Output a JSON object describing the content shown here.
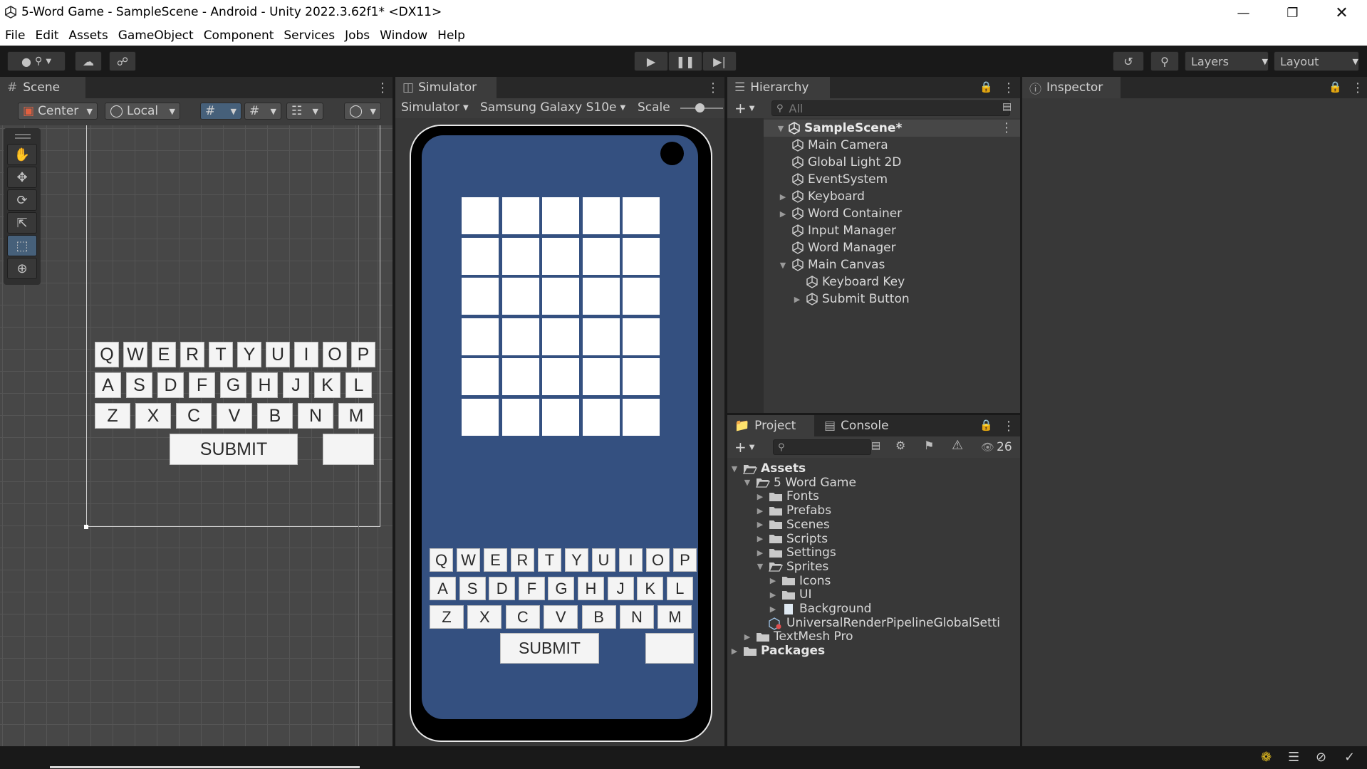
{
  "window": {
    "title": "5-Word Game - SampleScene - Android - Unity 2022.3.62f1* <DX11>"
  },
  "menu": [
    "File",
    "Edit",
    "Assets",
    "GameObject",
    "Component",
    "Services",
    "Jobs",
    "Window",
    "Help"
  ],
  "toolbar": {
    "layers_label": "Layers",
    "layout_label": "Layout"
  },
  "scene": {
    "tab_label": "Scene",
    "pivot_label": "Center",
    "space_label": "Local",
    "keyboard_rows": [
      [
        "Q",
        "W",
        "E",
        "R",
        "T",
        "Y",
        "U",
        "I",
        "O",
        "P"
      ],
      [
        "A",
        "S",
        "D",
        "F",
        "G",
        "H",
        "J",
        "K",
        "L"
      ],
      [
        "Z",
        "X",
        "C",
        "V",
        "B",
        "N",
        "M"
      ]
    ],
    "submit_label": "SUBMIT"
  },
  "simulator": {
    "tab_label": "Simulator",
    "mode_label": "Simulator",
    "device_label": "Samsung Galaxy S10e",
    "scale_label": "Scale",
    "keyboard_rows": [
      [
        "Q",
        "W",
        "E",
        "R",
        "T",
        "Y",
        "U",
        "I",
        "O",
        "P"
      ],
      [
        "A",
        "S",
        "D",
        "F",
        "G",
        "H",
        "J",
        "K",
        "L"
      ],
      [
        "Z",
        "X",
        "C",
        "V",
        "B",
        "N",
        "M"
      ]
    ],
    "submit_label": "SUBMIT",
    "screen_color": "#345080"
  },
  "hierarchy": {
    "tab_label": "Hierarchy",
    "search_placeholder": "All",
    "scene_name": "SampleScene*",
    "items": [
      {
        "label": "Main Camera",
        "depth": 1,
        "fold": ""
      },
      {
        "label": "Global Light 2D",
        "depth": 1,
        "fold": ""
      },
      {
        "label": "EventSystem",
        "depth": 1,
        "fold": ""
      },
      {
        "label": "Keyboard",
        "depth": 1,
        "fold": "▶"
      },
      {
        "label": "Word Container",
        "depth": 1,
        "fold": "▶"
      },
      {
        "label": "Input Manager",
        "depth": 1,
        "fold": ""
      },
      {
        "label": "Word Manager",
        "depth": 1,
        "fold": ""
      },
      {
        "label": "Main Canvas",
        "depth": 1,
        "fold": "▼"
      },
      {
        "label": "Keyboard Key",
        "depth": 2,
        "fold": ""
      },
      {
        "label": "Submit Button",
        "depth": 2,
        "fold": "▶"
      }
    ]
  },
  "inspector": {
    "tab_label": "Inspector"
  },
  "project": {
    "tab_project": "Project",
    "tab_console": "Console",
    "hidden_count": "26",
    "items": [
      {
        "label": "Assets",
        "depth": 0,
        "fold": "▼",
        "icon": "folder-open-icon",
        "bold": true
      },
      {
        "label": "5 Word Game",
        "depth": 1,
        "fold": "▼",
        "icon": "folder-open-icon",
        "bold": false
      },
      {
        "label": "Fonts",
        "depth": 2,
        "fold": "▶",
        "icon": "folder-icon",
        "bold": false
      },
      {
        "label": "Prefabs",
        "depth": 2,
        "fold": "▶",
        "icon": "folder-icon",
        "bold": false
      },
      {
        "label": "Scenes",
        "depth": 2,
        "fold": "▶",
        "icon": "folder-icon",
        "bold": false
      },
      {
        "label": "Scripts",
        "depth": 2,
        "fold": "▶",
        "icon": "folder-icon",
        "bold": false
      },
      {
        "label": "Settings",
        "depth": 2,
        "fold": "▶",
        "icon": "folder-icon",
        "bold": false
      },
      {
        "label": "Sprites",
        "depth": 2,
        "fold": "▼",
        "icon": "folder-open-icon",
        "bold": false
      },
      {
        "label": "Icons",
        "depth": 3,
        "fold": "▶",
        "icon": "folder-icon",
        "bold": false
      },
      {
        "label": "UI",
        "depth": 3,
        "fold": "▶",
        "icon": "folder-icon",
        "bold": false
      },
      {
        "label": "Background",
        "depth": 3,
        "fold": "▶",
        "icon": "sprite-icon",
        "bold": false
      },
      {
        "label": "UniversalRenderPipelineGlobalSetti",
        "depth": 2,
        "fold": "",
        "icon": "settings-asset-icon",
        "bold": false
      },
      {
        "label": "TextMesh Pro",
        "depth": 1,
        "fold": "▶",
        "icon": "folder-icon",
        "bold": false
      },
      {
        "label": "Packages",
        "depth": 0,
        "fold": "▶",
        "icon": "folder-icon",
        "bold": true
      }
    ]
  }
}
